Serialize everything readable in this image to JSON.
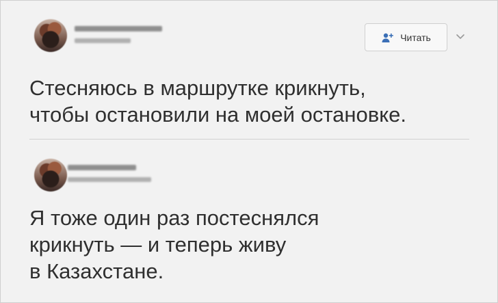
{
  "tweet1": {
    "follow_label": "Читать",
    "text_lines": [
      "Стесняюсь в маршрутке крикнуть,",
      "чтобы остановили на моей остановке."
    ]
  },
  "tweet2": {
    "text_lines": [
      "Я тоже один раз постеснялся",
      "крикнуть — и теперь живу",
      "в Казахстане."
    ]
  },
  "icons": {
    "follow": "add-user-icon",
    "menu": "chevron-down-icon"
  },
  "colors": {
    "background": "#f2f2f2",
    "text": "#2f2f2f",
    "accent": "#3b6fb6"
  }
}
